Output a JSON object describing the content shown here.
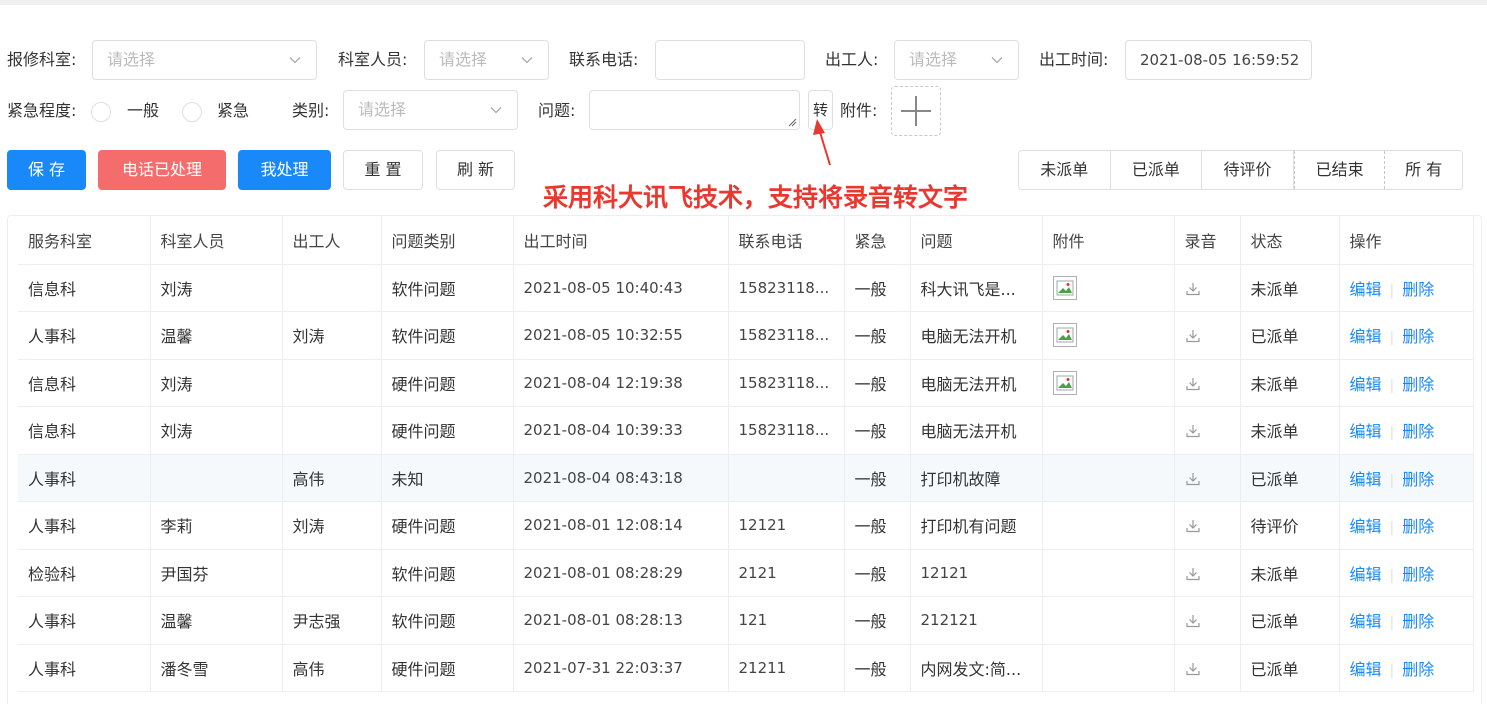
{
  "form": {
    "dept_label": "报修科室:",
    "dept_placeholder": "请选择",
    "staff_label": "科室人员:",
    "staff_placeholder": "请选择",
    "phone_label": "联系电话:",
    "phone_value": "",
    "worker_label": "出工人:",
    "worker_placeholder": "请选择",
    "time_label": "出工时间:",
    "time_value": "2021-08-05 16:59:52",
    "urgency_label": "紧急程度:",
    "urgency_options": [
      "一般",
      "紧急"
    ],
    "category_label": "类别:",
    "category_placeholder": "请选择",
    "problem_label": "问题:",
    "problem_value": "",
    "convert_label": "转",
    "attach_label": "附件:"
  },
  "toolbar": {
    "save": "保 存",
    "phone_handled": "电话已处理",
    "i_handle": "我处理",
    "reset": "重 置",
    "refresh": "刷 新"
  },
  "filter_tabs": [
    "未派单",
    "已派单",
    "待评价",
    "已结束",
    "所 有"
  ],
  "annotation": "采用科大讯飞技术，支持将录音转文字",
  "table": {
    "headers": [
      "服务科室",
      "科室人员",
      "出工人",
      "问题类别",
      "出工时间",
      "联系电话",
      "紧急",
      "问题",
      "附件",
      "录音",
      "状态",
      "操作"
    ],
    "edit_label": "编辑",
    "delete_label": "删除",
    "rows": [
      {
        "dept": "信息科",
        "staff": "刘涛",
        "worker": "",
        "category": "软件问题",
        "time": "2021-08-05 10:40:43",
        "phone": "15823118...",
        "urgency": "一般",
        "problem": "科大讯飞是...",
        "has_attachment": true,
        "status": "未派单"
      },
      {
        "dept": "人事科",
        "staff": "温馨",
        "worker": "刘涛",
        "category": "软件问题",
        "time": "2021-08-05 10:32:55",
        "phone": "15823118...",
        "urgency": "一般",
        "problem": "电脑无法开机",
        "has_attachment": true,
        "status": "已派单"
      },
      {
        "dept": "信息科",
        "staff": "刘涛",
        "worker": "",
        "category": "硬件问题",
        "time": "2021-08-04 12:19:38",
        "phone": "15823118...",
        "urgency": "一般",
        "problem": "电脑无法开机",
        "has_attachment": true,
        "status": "未派单"
      },
      {
        "dept": "信息科",
        "staff": "刘涛",
        "worker": "",
        "category": "硬件问题",
        "time": "2021-08-04 10:39:33",
        "phone": "15823118...",
        "urgency": "一般",
        "problem": "电脑无法开机",
        "has_attachment": false,
        "status": "未派单"
      },
      {
        "dept": "人事科",
        "staff": "",
        "worker": "高伟",
        "category": "未知",
        "time": "2021-08-04 08:43:18",
        "phone": "",
        "urgency": "一般",
        "problem": "打印机故障",
        "has_attachment": false,
        "status": "已派单"
      },
      {
        "dept": "人事科",
        "staff": "李莉",
        "worker": "刘涛",
        "category": "硬件问题",
        "time": "2021-08-01 12:08:14",
        "phone": "12121",
        "urgency": "一般",
        "problem": "打印机有问题",
        "has_attachment": false,
        "status": "待评价"
      },
      {
        "dept": "检验科",
        "staff": "尹国芬",
        "worker": "",
        "category": "软件问题",
        "time": "2021-08-01 08:28:29",
        "phone": "2121",
        "urgency": "一般",
        "problem": "12121",
        "has_attachment": false,
        "status": "未派单"
      },
      {
        "dept": "人事科",
        "staff": "温馨",
        "worker": "尹志强",
        "category": "软件问题",
        "time": "2021-08-01 08:28:13",
        "phone": "121",
        "urgency": "一般",
        "problem": "212121",
        "has_attachment": false,
        "status": "已派单"
      },
      {
        "dept": "人事科",
        "staff": "潘冬雪",
        "worker": "高伟",
        "category": "硬件问题",
        "time": "2021-07-31 22:03:37",
        "phone": "21211",
        "urgency": "一般",
        "problem": "内网发文:简...",
        "has_attachment": false,
        "status": "已派单"
      }
    ]
  },
  "colors": {
    "primary": "#1989fa",
    "danger": "#f56c6c",
    "annotation": "#e8382f"
  }
}
